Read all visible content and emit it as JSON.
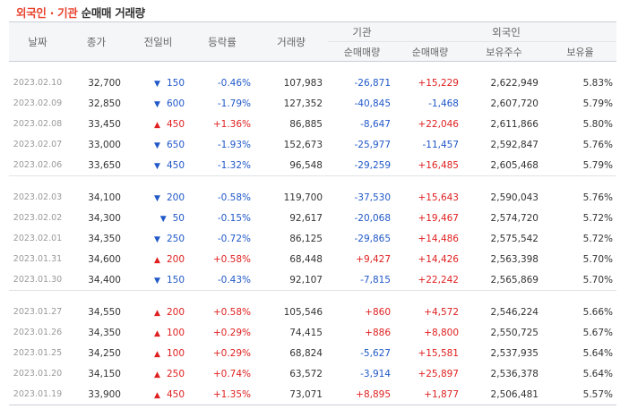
{
  "title": {
    "part1": "외국인 · 기관",
    "part2": " 순매매 거래량"
  },
  "headers": {
    "date": "날짜",
    "close": "종가",
    "change": "전일비",
    "rate": "등락률",
    "volume": "거래량",
    "institution": "기관",
    "foreign": "외국인",
    "inst_net": "순매매량",
    "foreign_net": "순매매량",
    "holdings": "보유주수",
    "holding_ratio": "보유율"
  },
  "colors": {
    "up": "#e02020",
    "down": "#2058c8",
    "title_accent": "#e8432e"
  },
  "groups": [
    {
      "rows": [
        {
          "date": "2023.02.10",
          "close": "32,700",
          "dir": "down",
          "change": "150",
          "rate": "-0.46%",
          "volume": "107,983",
          "inst": "-26,871",
          "foreign": "+15,229",
          "holdings": "2,622,949",
          "ratio": "5.83%"
        },
        {
          "date": "2023.02.09",
          "close": "32,850",
          "dir": "down",
          "change": "600",
          "rate": "-1.79%",
          "volume": "127,352",
          "inst": "-40,845",
          "foreign": "-1,468",
          "holdings": "2,607,720",
          "ratio": "5.79%"
        },
        {
          "date": "2023.02.08",
          "close": "33,450",
          "dir": "up",
          "change": "450",
          "rate": "+1.36%",
          "volume": "86,885",
          "inst": "-8,647",
          "foreign": "+22,046",
          "holdings": "2,611,866",
          "ratio": "5.80%"
        },
        {
          "date": "2023.02.07",
          "close": "33,000",
          "dir": "down",
          "change": "650",
          "rate": "-1.93%",
          "volume": "152,673",
          "inst": "-25,977",
          "foreign": "-11,457",
          "holdings": "2,592,847",
          "ratio": "5.76%"
        },
        {
          "date": "2023.02.06",
          "close": "33,650",
          "dir": "down",
          "change": "450",
          "rate": "-1.32%",
          "volume": "96,548",
          "inst": "-29,259",
          "foreign": "+16,485",
          "holdings": "2,605,468",
          "ratio": "5.79%"
        }
      ]
    },
    {
      "rows": [
        {
          "date": "2023.02.03",
          "close": "34,100",
          "dir": "down",
          "change": "200",
          "rate": "-0.58%",
          "volume": "119,700",
          "inst": "-37,530",
          "foreign": "+15,643",
          "holdings": "2,590,043",
          "ratio": "5.76%"
        },
        {
          "date": "2023.02.02",
          "close": "34,300",
          "dir": "down",
          "change": "50",
          "rate": "-0.15%",
          "volume": "92,617",
          "inst": "-20,068",
          "foreign": "+19,467",
          "holdings": "2,574,720",
          "ratio": "5.72%"
        },
        {
          "date": "2023.02.01",
          "close": "34,350",
          "dir": "down",
          "change": "250",
          "rate": "-0.72%",
          "volume": "86,125",
          "inst": "-29,865",
          "foreign": "+14,486",
          "holdings": "2,575,542",
          "ratio": "5.72%"
        },
        {
          "date": "2023.01.31",
          "close": "34,600",
          "dir": "up",
          "change": "200",
          "rate": "+0.58%",
          "volume": "68,448",
          "inst": "+9,427",
          "foreign": "+14,426",
          "holdings": "2,563,398",
          "ratio": "5.70%"
        },
        {
          "date": "2023.01.30",
          "close": "34,400",
          "dir": "down",
          "change": "150",
          "rate": "-0.43%",
          "volume": "92,107",
          "inst": "-7,815",
          "foreign": "+22,242",
          "holdings": "2,565,869",
          "ratio": "5.70%"
        }
      ]
    },
    {
      "rows": [
        {
          "date": "2023.01.27",
          "close": "34,550",
          "dir": "up",
          "change": "200",
          "rate": "+0.58%",
          "volume": "105,546",
          "inst": "+860",
          "foreign": "+4,572",
          "holdings": "2,546,224",
          "ratio": "5.66%"
        },
        {
          "date": "2023.01.26",
          "close": "34,350",
          "dir": "up",
          "change": "100",
          "rate": "+0.29%",
          "volume": "74,415",
          "inst": "+886",
          "foreign": "+8,800",
          "holdings": "2,550,725",
          "ratio": "5.67%"
        },
        {
          "date": "2023.01.25",
          "close": "34,250",
          "dir": "up",
          "change": "100",
          "rate": "+0.29%",
          "volume": "68,824",
          "inst": "-5,627",
          "foreign": "+15,581",
          "holdings": "2,537,935",
          "ratio": "5.64%"
        },
        {
          "date": "2023.01.20",
          "close": "34,150",
          "dir": "up",
          "change": "250",
          "rate": "+0.74%",
          "volume": "63,572",
          "inst": "-3,914",
          "foreign": "+25,897",
          "holdings": "2,536,378",
          "ratio": "5.64%"
        },
        {
          "date": "2023.01.19",
          "close": "33,900",
          "dir": "up",
          "change": "450",
          "rate": "+1.35%",
          "volume": "73,071",
          "inst": "+8,895",
          "foreign": "+1,877",
          "holdings": "2,506,481",
          "ratio": "5.57%"
        }
      ]
    }
  ]
}
